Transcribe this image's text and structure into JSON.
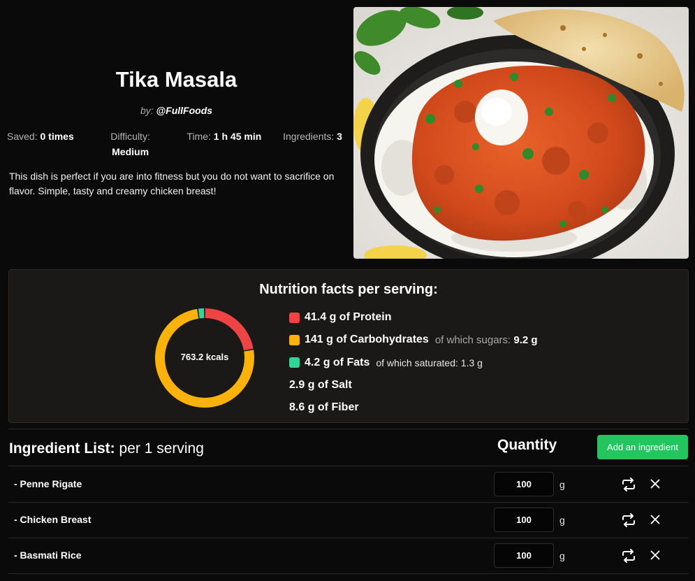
{
  "recipe": {
    "title": "Tika Masala",
    "byline_prefix": "by:",
    "author": "@FullFoods",
    "stats": {
      "saved_label": "Saved:",
      "saved_value": "0 times",
      "difficulty_label": "Difficulty:",
      "difficulty_value": "Medium",
      "time_label": "Time:",
      "time_value": "1 h 45 min",
      "ingredients_label": "Ingredients:",
      "ingredients_value": "3"
    },
    "description": "This dish is perfect if you are into fitness but you do not want to sacrifice on flavor. Simple, tasty and creamy chicken breast!",
    "image_icon": "dish-photo"
  },
  "nutrition": {
    "title": "Nutrition facts per serving:",
    "kcals_label": "763.2 kcals",
    "macros": [
      {
        "main": "41.4 g of Protein",
        "color": "#ef4444"
      },
      {
        "main": "141 g of Carbohydrates",
        "extra_label": "of which sugars:",
        "extra_value": "9.2 g",
        "color": "#fbb20a"
      },
      {
        "main": "4.2 g of Fats",
        "extra_label": "of which saturated:",
        "extra_value": "1.3 g",
        "color": "#34d399"
      },
      {
        "main": "2.9 g of Salt"
      },
      {
        "main": "8.6 g of Fiber"
      }
    ]
  },
  "chart_data": {
    "type": "pie",
    "labels": [
      "Protein",
      "Carbohydrates",
      "Fats"
    ],
    "values": [
      41.4,
      141,
      4.2
    ],
    "colors": [
      "#ef4444",
      "#fbb20a",
      "#34d399"
    ],
    "center_label": "763.2 kcals"
  },
  "ingredients": {
    "heading_bold": "Ingredient List:",
    "heading_rest": "per 1 serving",
    "quantity_heading": "Quantity",
    "add_button": "Add an ingredient",
    "items": [
      {
        "name": "- Penne Rigate",
        "quantity": "100",
        "unit": "g"
      },
      {
        "name": "- Chicken Breast",
        "quantity": "100",
        "unit": "g"
      },
      {
        "name": "- Basmati Rice",
        "quantity": "100",
        "unit": "g"
      }
    ],
    "swap_icon": "swap-icon",
    "remove_icon": "close-icon"
  }
}
